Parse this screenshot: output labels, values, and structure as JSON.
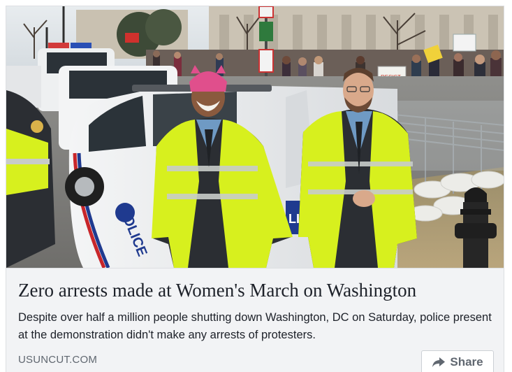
{
  "post": {
    "headline": "Zero arrests made at Women's March on Washington",
    "description": "Despite over half a million people shutting down Washington, DC on Saturday, police present at the demonstration didn't make any arrests of protesters.",
    "domain": "USUNCUT.COM",
    "share_label": "Share",
    "share_icon": "share-arrow-icon"
  },
  "photo": {
    "car_door_text": "POLICE",
    "car_door_text_right": "LIC",
    "sign_text": "RESIST",
    "bumper_text": "POLICE"
  },
  "colors": {
    "card_bg": "#f2f3f5",
    "headline": "#1d2129",
    "meta": "#606770",
    "hi_vis_yellow": "#d7f01e",
    "jacket_dark": "#2b2e33",
    "hat_pink": "#e04f8c"
  }
}
